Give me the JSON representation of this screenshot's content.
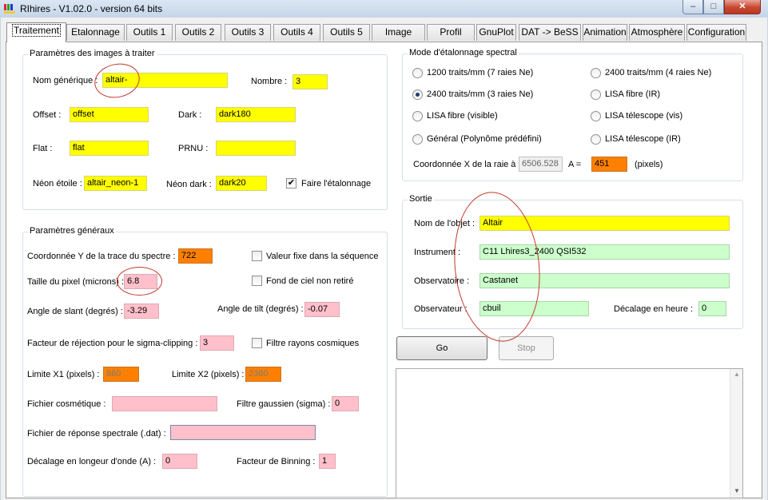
{
  "window": {
    "title": "RIhires - V1.02.0 - version 64 bits",
    "min": "–",
    "max": "□",
    "close": "✕"
  },
  "tabs": [
    "Traitement",
    "Etalonnage",
    "Outils 1",
    "Outils 2",
    "Outils 3",
    "Outils 4",
    "Outils 5",
    "Image",
    "Profil",
    "GnuPlot",
    "DAT -> BeSS",
    "Animation",
    "Atmosphère",
    "Configuration"
  ],
  "images": {
    "title": "Paramètres des images à traiter",
    "nom_label": "Nom générique :",
    "nom_value": "altair-",
    "nombre_label": "Nombre :",
    "nombre_value": "3",
    "offset_label": "Offset :",
    "offset_value": "offset",
    "dark_label": "Dark :",
    "dark_value": "dark180",
    "flat_label": "Flat :",
    "flat_value": "flat",
    "prnu_label": "PRNU :",
    "prnu_value": "",
    "neon_etoile_label": "Néon étoile :",
    "neon_etoile_value": "altair_neon-1",
    "neon_dark_label": "Néon dark :",
    "neon_dark_value": "dark20",
    "faire_label": "Faire l'étalonnage",
    "faire_checked": "✔"
  },
  "general": {
    "title": "Paramètres généraux",
    "coordY_label": "Coordonnée Y de la trace du spectre :",
    "coordY_value": "722",
    "valeur_fixe_label": "Valeur fixe dans la séquence",
    "pixel_label": "Taille du pixel (microns) :",
    "pixel_value": "6.8",
    "fond_label": "Fond de ciel non retiré",
    "slant_label": "Angle de slant (degrés) :",
    "slant_value": "-3.29",
    "tilt_label": "Angle de tilt (degrés) :",
    "tilt_value": "-0.07",
    "rejection_label": "Facteur de réjection pour le sigma-clipping :",
    "rejection_value": "3",
    "filtre_cosmic_label": "Filtre rayons cosmiques",
    "x1_label": "Limite X1 (pixels) :",
    "x1_value": "860",
    "x2_label": "Limite X2 (pixels) :",
    "x2_value": "2380",
    "cosmetique_label": "Fichier cosmétique :",
    "cosmetique_value": "",
    "gaussien_label": "Filtre gaussien (sigma) :",
    "gaussien_value": "0",
    "reponse_label": "Fichier de réponse spectrale (.dat) :",
    "reponse_value": "",
    "decalage_label": "Décalage en longeur d'onde (A) :",
    "decalage_value": "0",
    "binning_label": "Facteur de Binning :",
    "binning_value": "1"
  },
  "mode": {
    "title": "Mode d'étalonnage spectral",
    "r1": "1200 traits/mm (7 raies Ne)",
    "r2": "2400 traits/mm (4 raies Ne)",
    "r3": "2400 traits/mm (3 raies Ne)",
    "r4": "LISA fibre (IR)",
    "r5": "LISA fibre (visible)",
    "r6": "LISA télescope (vis)",
    "r7": "Général (Polynôme prédéfini)",
    "r8": "LISA télescope (IR)",
    "coordX_label": "Coordonnée X de la raie à",
    "coordX_value": "6506.528",
    "a_label": "A  =",
    "a_value": "451",
    "pixels_label": "(pixels)"
  },
  "sortie": {
    "title": "Sortie",
    "objet_label": "Nom de l'objet :",
    "objet_value": "Altair",
    "instrument_label": "Instrument :",
    "instrument_value": "C11 Lhires3_2400 QSI532",
    "observatoire_label": "Observatoire :",
    "observatoire_value": "Castanet",
    "observateur_label": "Observateur :",
    "observateur_value": "cbuil",
    "heure_label": "Décalage en heure :",
    "heure_value": "0"
  },
  "buttons": {
    "go": "Go",
    "stop": "Stop"
  },
  "scroll": {
    "up": "▲",
    "down": "▼"
  }
}
